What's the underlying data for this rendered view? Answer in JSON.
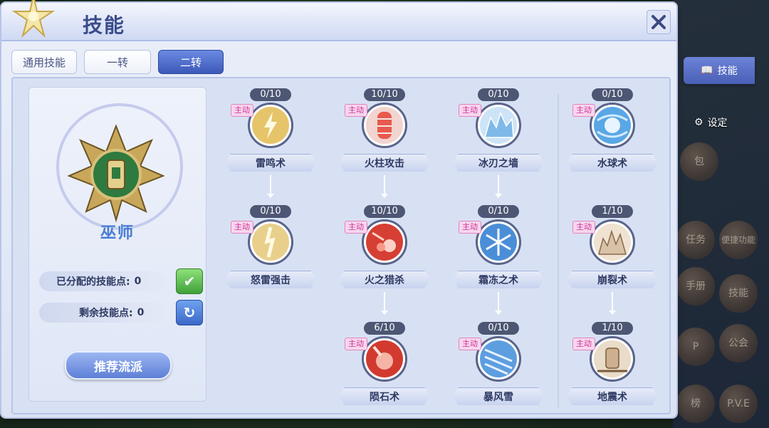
{
  "window": {
    "title": "技能"
  },
  "tabs": [
    {
      "label": "通用技能",
      "active": false
    },
    {
      "label": "一转",
      "active": false
    },
    {
      "label": "二转",
      "active": true
    }
  ],
  "class_panel": {
    "class_name": "巫师",
    "allocated_label": "已分配的技能点:",
    "allocated_value": "0",
    "remaining_label": "剩余技能点:",
    "remaining_value": "0",
    "recommend_label": "推荐流派"
  },
  "skills": [
    {
      "name": "雷鸣术",
      "level": "0/10",
      "tag": "主动",
      "icon": "lightning-icon",
      "color": "#e6c46a"
    },
    {
      "name": "怒雷强击",
      "level": "0/10",
      "tag": "主动",
      "icon": "thunder-strike-icon",
      "color": "#e8d08c"
    },
    {
      "name": "火柱攻击",
      "level": "10/10",
      "tag": "主动",
      "icon": "fire-pillar-icon",
      "color": "#e85a4e"
    },
    {
      "name": "火之猎杀",
      "level": "10/10",
      "tag": "主动",
      "icon": "fire-hunt-icon",
      "color": "#d63f34"
    },
    {
      "name": "陨石术",
      "level": "6/10",
      "tag": "主动",
      "icon": "meteor-icon",
      "color": "#d23a2f"
    },
    {
      "name": "冰刃之墙",
      "level": "0/10",
      "tag": "主动",
      "icon": "ice-wall-icon",
      "color": "#7fb9e8"
    },
    {
      "name": "霜冻之术",
      "level": "0/10",
      "tag": "主动",
      "icon": "snowflake-icon",
      "color": "#4b8ed8"
    },
    {
      "name": "暴风雪",
      "level": "0/10",
      "tag": "主动",
      "icon": "blizzard-icon",
      "color": "#5d9ee0"
    },
    {
      "name": "水球术",
      "level": "0/10",
      "tag": "主动",
      "icon": "water-ball-icon",
      "color": "#5aa7e6"
    },
    {
      "name": "崩裂术",
      "level": "1/10",
      "tag": "主动",
      "icon": "crack-icon",
      "color": "#d8c2a8"
    },
    {
      "name": "地震术",
      "level": "1/10",
      "tag": "主动",
      "icon": "earthquake-icon",
      "color": "#cdb08f"
    }
  ],
  "sidebar": {
    "skill_tab": "技能",
    "settings": "设定",
    "tiles": [
      "包",
      "任务",
      "便捷功能",
      "手册",
      "技能",
      "P",
      "公会",
      "榜",
      "P.V.E"
    ]
  }
}
